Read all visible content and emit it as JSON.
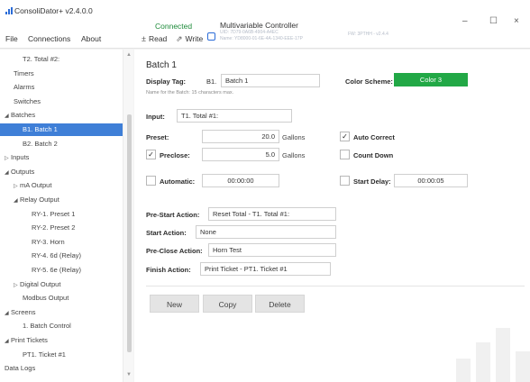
{
  "app": {
    "title": "ConsoliDator+ v2.4.0.0",
    "menu": [
      "File",
      "Connections",
      "About"
    ],
    "status": "Connected",
    "toolbar": {
      "read": "Read",
      "write": "Write"
    },
    "device": {
      "title": "Multivariable Controller",
      "line1": "UID: 7D79-0A6B-4904-A4EC",
      "line2": "Name: YD8000-01-6E-4A-1340-EEE-17P",
      "firmware": "FW: 3PTHH - v2.4.4"
    },
    "window_controls": {
      "minimize": "–",
      "maximize": "☐",
      "close": "×"
    },
    "colors": {
      "selection": "#3f7fd7",
      "status": "#1e8b3a",
      "scheme": "#22a846"
    }
  },
  "sidebar": {
    "items": [
      {
        "label": "T2. Total #2:",
        "indent": 2,
        "expander": ""
      },
      {
        "label": "Timers",
        "indent": 1,
        "expander": ""
      },
      {
        "label": "Alarms",
        "indent": 1,
        "expander": ""
      },
      {
        "label": "Switches",
        "indent": 1,
        "expander": ""
      },
      {
        "label": "Batches",
        "indent": 0,
        "expander": "◢"
      },
      {
        "label": "B1. Batch 1",
        "indent": 2,
        "expander": "",
        "selected": true
      },
      {
        "label": "B2. Batch 2",
        "indent": 2,
        "expander": ""
      },
      {
        "label": "Inputs",
        "indent": 0,
        "expander": "▷"
      },
      {
        "label": "Outputs",
        "indent": 0,
        "expander": "◢"
      },
      {
        "label": "mA Output",
        "indent": 1,
        "expander": "▷"
      },
      {
        "label": "Relay Output",
        "indent": 1,
        "expander": "◢"
      },
      {
        "label": "RY-1. Preset 1",
        "indent": 3,
        "expander": ""
      },
      {
        "label": "RY-2. Preset 2",
        "indent": 3,
        "expander": ""
      },
      {
        "label": "RY-3. Horn",
        "indent": 3,
        "expander": ""
      },
      {
        "label": "RY-4. 6d (Relay)",
        "indent": 3,
        "expander": ""
      },
      {
        "label": "RY-5. 6e (Relay)",
        "indent": 3,
        "expander": ""
      },
      {
        "label": "Digital Output",
        "indent": 1,
        "expander": "▷"
      },
      {
        "label": "Modbus Output",
        "indent": 2,
        "expander": ""
      },
      {
        "label": "Screens",
        "indent": 0,
        "expander": "◢"
      },
      {
        "label": "1. Batch Control",
        "indent": 2,
        "expander": ""
      },
      {
        "label": "Print Tickets",
        "indent": 0,
        "expander": "◢"
      },
      {
        "label": "PT1. Ticket #1",
        "indent": 2,
        "expander": ""
      },
      {
        "label": "Data Logs",
        "indent": 0,
        "expander": ""
      }
    ]
  },
  "form": {
    "title": "Batch 1",
    "display_tag": {
      "label": "Display Tag:",
      "prefix": "B1.",
      "value": "Batch 1",
      "hint": "Name for the Batch: 15 characters max."
    },
    "color_scheme": {
      "label": "Color Scheme:",
      "value": "Color 3"
    },
    "input": {
      "label": "Input:",
      "value": "T1. Total #1:"
    },
    "preset": {
      "label": "Preset:",
      "value": "20.0",
      "unit": "Gallons"
    },
    "preclose": {
      "label": "Preclose:",
      "checked": "✓",
      "value": "5.0",
      "unit": "Gallons"
    },
    "auto_correct": {
      "label": "Auto Correct",
      "checked": "✓"
    },
    "count_down": {
      "label": "Count Down",
      "checked": ""
    },
    "automatic": {
      "label": "Automatic:",
      "checked": "",
      "value": "00:00:00"
    },
    "start_delay": {
      "label": "Start Delay:",
      "checked": "",
      "value": "00:00:05"
    },
    "pre_start_action": {
      "label": "Pre-Start Action:",
      "value": "Reset Total - T1. Total #1:"
    },
    "start_action": {
      "label": "Start Action:",
      "value": "None"
    },
    "pre_close_action": {
      "label": "Pre-Close Action:",
      "value": "Horn Test"
    },
    "finish_action": {
      "label": "Finish Action:",
      "value": "Print Ticket - PT1. Ticket #1"
    },
    "buttons": {
      "new": "New",
      "copy": "Copy",
      "delete": "Delete"
    }
  }
}
